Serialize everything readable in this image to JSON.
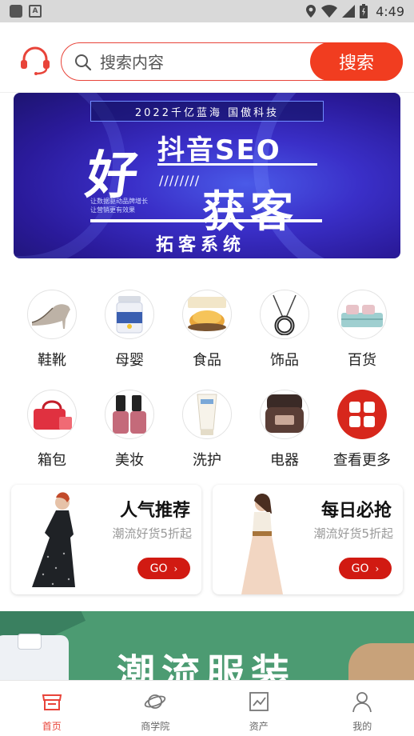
{
  "status_bar": {
    "time": "4:49"
  },
  "search": {
    "placeholder": "搜索内容",
    "button_label": "搜索"
  },
  "banner": {
    "top_text": "2022千亿蓝海 国傲科技",
    "hao": "好",
    "seo_text": "抖音SEO",
    "slashes": "////////",
    "small_line1": "让数据驱动品牌增长",
    "small_line2": "让营销更有效果",
    "huoke": "获客",
    "system_text": "拓客系统"
  },
  "categories": [
    {
      "label": "鞋靴",
      "icon": "heel-shoe-icon"
    },
    {
      "label": "母婴",
      "icon": "milk-powder-icon"
    },
    {
      "label": "食品",
      "icon": "pastry-icon"
    },
    {
      "label": "饰品",
      "icon": "necklace-icon"
    },
    {
      "label": "百货",
      "icon": "bedding-icon"
    },
    {
      "label": "箱包",
      "icon": "handbag-icon"
    },
    {
      "label": "美妆",
      "icon": "nail-polish-icon"
    },
    {
      "label": "洗护",
      "icon": "lotion-tube-icon"
    },
    {
      "label": "电器",
      "icon": "rice-cooker-icon"
    },
    {
      "label": "查看更多",
      "icon": "grid-more-icon"
    }
  ],
  "promos": [
    {
      "title": "人气推荐",
      "subtitle": "潮流好货5折起",
      "button": "GO"
    },
    {
      "title": "每日必抢",
      "subtitle": "潮流好货5折起",
      "button": "GO"
    }
  ],
  "fashion_banner": {
    "text": "潮流服装"
  },
  "tabs": [
    {
      "label": "首页",
      "icon": "home-store-icon",
      "active": true
    },
    {
      "label": "商学院",
      "icon": "planet-icon",
      "active": false
    },
    {
      "label": "资产",
      "icon": "chart-icon",
      "active": false
    },
    {
      "label": "我的",
      "icon": "user-icon",
      "active": false
    }
  ],
  "colors": {
    "accent": "#f13d20",
    "go_button": "#d11a12",
    "tab_active": "#e8443a",
    "fashion_bg": "#4c9b72"
  }
}
